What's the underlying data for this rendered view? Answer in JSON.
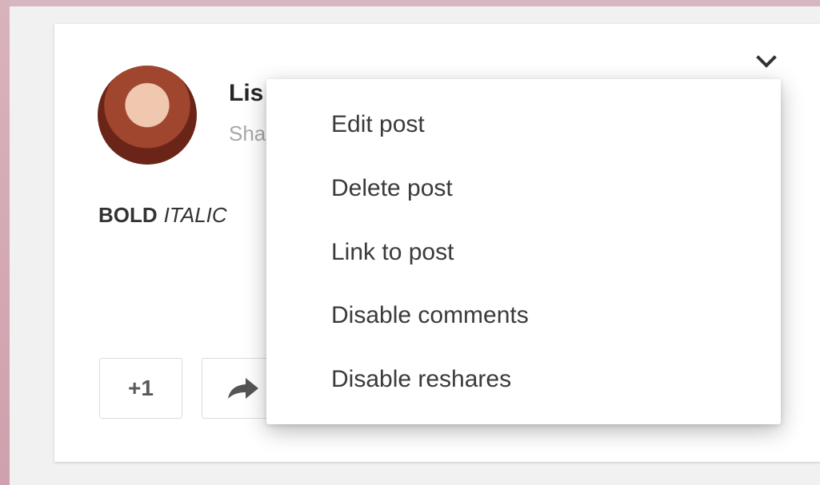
{
  "post": {
    "author_name": "Lis",
    "share_text": "Sha",
    "text_bold": "BOLD",
    "text_italic": "ITALIC"
  },
  "actions": {
    "plusone_label": "+1"
  },
  "menu": {
    "items": [
      {
        "label": "Edit post"
      },
      {
        "label": "Delete post"
      },
      {
        "label": "Link to post"
      },
      {
        "label": "Disable comments"
      },
      {
        "label": "Disable reshares"
      }
    ]
  },
  "icons": {
    "options": "chevron-down-icon",
    "reshare": "share-arrow-icon"
  },
  "colors": {
    "page_background": "#f1f1f1",
    "card": "#ffffff",
    "left_edge": "#d9b3bc"
  }
}
